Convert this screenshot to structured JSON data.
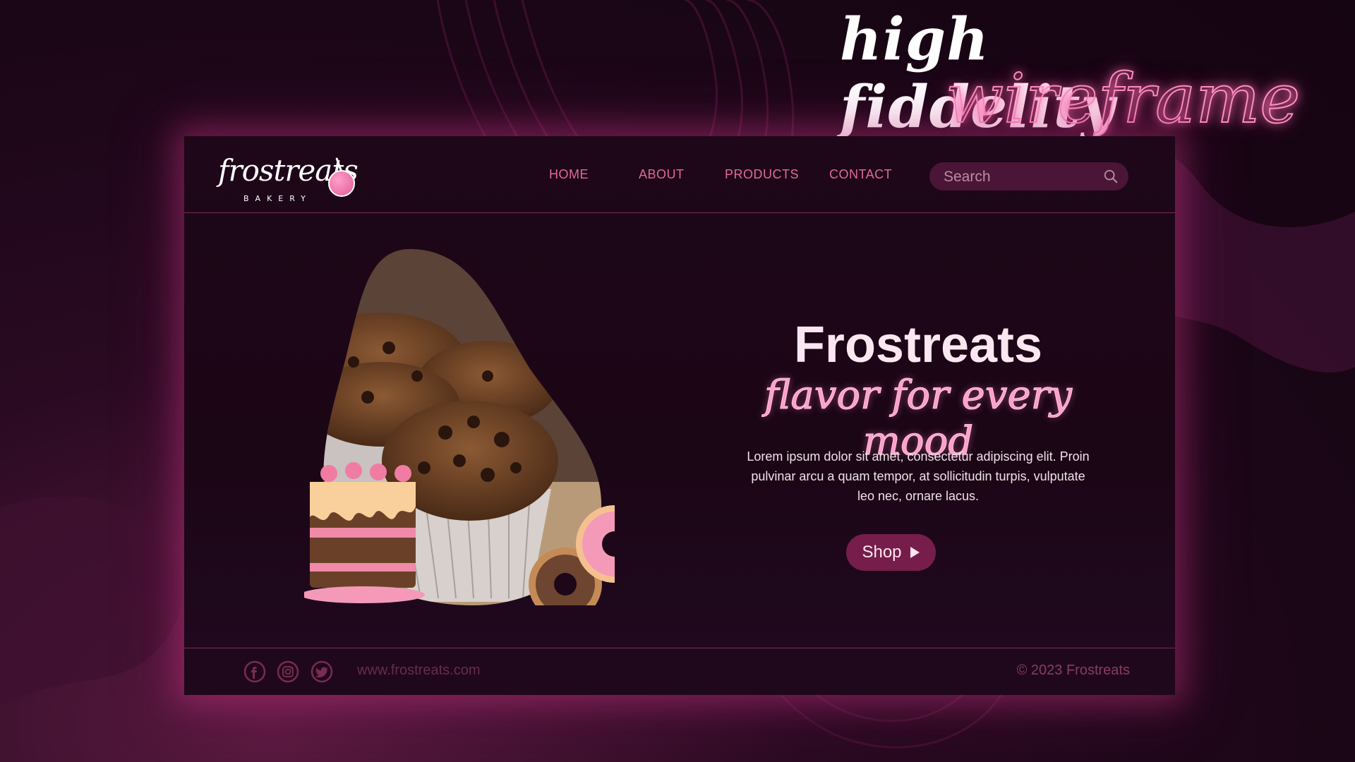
{
  "headline": {
    "line1": "high fiddelity",
    "line2": "wireframe"
  },
  "brand": {
    "logo_text": "frostreats",
    "logo_sub": "BAKERY"
  },
  "nav": {
    "items": [
      {
        "label": "HOME"
      },
      {
        "label": "ABOUT"
      },
      {
        "label": "PRODUCTS"
      },
      {
        "label": "CONTACT"
      }
    ]
  },
  "search": {
    "placeholder": "Search",
    "icon": "search-icon"
  },
  "hero": {
    "title": "Frostreats",
    "tagline": "flavor for every mood",
    "body": "Lorem ipsum dolor sit amet, consectetur adipiscing elit. Proin pulvinar arcu a quam tempor, at sollicitudin turpis, vulputate leo nec, ornare lacus.",
    "cta_label": "Shop",
    "cta_icon": "play-icon"
  },
  "footer": {
    "social": [
      {
        "icon": "facebook-icon"
      },
      {
        "icon": "instagram-icon"
      },
      {
        "icon": "twitter-icon"
      }
    ],
    "url": "www.frostreats.com",
    "copyright": "© 2023 Frostreats"
  },
  "colors": {
    "accent": "#e4679f",
    "button": "#761d4b",
    "background": "#1b0616",
    "glow": "#ff8fc0"
  }
}
